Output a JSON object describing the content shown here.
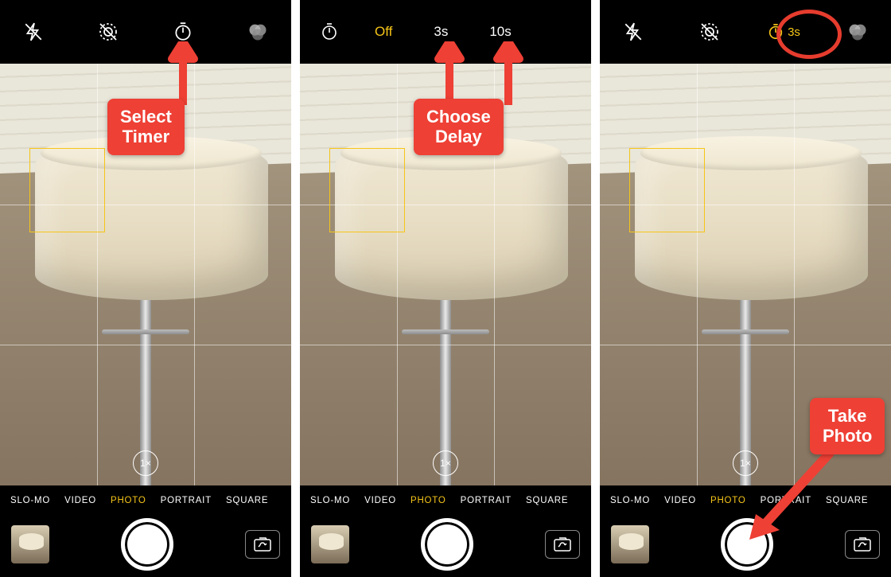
{
  "modes": [
    "SLO-MO",
    "VIDEO",
    "PHOTO",
    "PORTRAIT",
    "SQUARE"
  ],
  "selected_mode": "PHOTO",
  "zoom_label": "1×",
  "timer_options": {
    "off": "Off",
    "three": "3s",
    "ten": "10s"
  },
  "timer_selected_label": "3s",
  "callouts": {
    "select_timer_l1": "Select",
    "select_timer_l2": "Timer",
    "choose_delay_l1": "Choose",
    "choose_delay_l2": "Delay",
    "take_photo_l1": "Take",
    "take_photo_l2": "Photo"
  },
  "icons": {
    "flash": "flash-off-icon",
    "live": "live-off-icon",
    "timer": "timer-icon",
    "filters": "filters-icon",
    "flip": "flip-camera-icon"
  }
}
